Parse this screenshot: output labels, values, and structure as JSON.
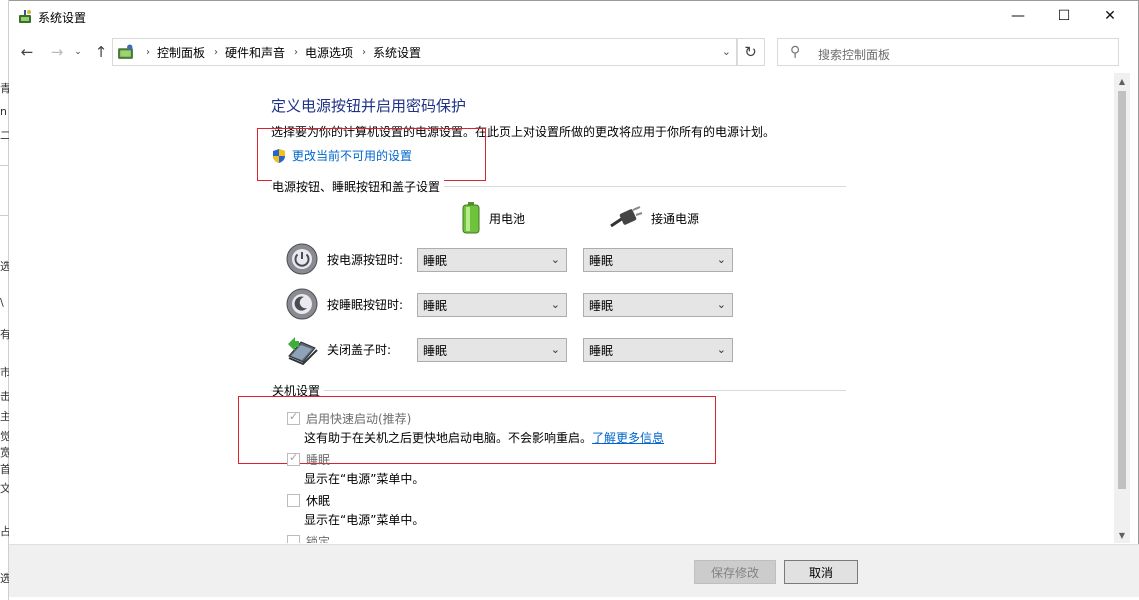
{
  "window": {
    "title": "系统设置",
    "controls": {
      "minimize": "—",
      "maximize": "☐",
      "close": "✕"
    }
  },
  "address_bar": {
    "breadcrumbs": [
      "控制面板",
      "硬件和声音",
      "电源选项",
      "系统设置"
    ],
    "search_placeholder": "搜索控制面板"
  },
  "page": {
    "heading": "定义电源按钮并启用密码保护",
    "description": "选择要为你的计算机设置的电源设置。在此页上对设置所做的更改将应用于你所有的电源计划。",
    "change_settings_link": "更改当前不可用的设置"
  },
  "power_buttons": {
    "group_title": "电源按钮、睡眠按钮和盖子设置",
    "columns": {
      "battery": "用电池",
      "plugged_in": "接通电源"
    },
    "rows": [
      {
        "label": "按电源按钮时:",
        "battery": "睡眠",
        "plugged_in": "睡眠",
        "icon": "power-button-icon"
      },
      {
        "label": "按睡眠按钮时:",
        "battery": "睡眠",
        "plugged_in": "睡眠",
        "icon": "sleep-button-icon"
      },
      {
        "label": "关闭盖子时:",
        "battery": "睡眠",
        "plugged_in": "睡眠",
        "icon": "laptop-lid-icon"
      }
    ]
  },
  "shutdown_settings": {
    "group_title": "关机设置",
    "items": [
      {
        "label": "启用快速启动(推荐)",
        "checked": true,
        "disabled": true,
        "description": "这有助于在关机之后更快地启动电脑。不会影响重启。",
        "link": "了解更多信息"
      },
      {
        "label": "睡眠",
        "checked": true,
        "disabled": true,
        "description": "显示在“电源”菜单中。"
      },
      {
        "label": "休眠",
        "checked": false,
        "disabled": false,
        "description": "显示在“电源”菜单中。"
      },
      {
        "label": "锁定",
        "checked": false,
        "disabled": true
      }
    ]
  },
  "footer": {
    "save_button": "保存修改",
    "cancel_button": "取消"
  },
  "colors": {
    "heading": "#1e3287",
    "link": "#0066cc",
    "highlight_box": "#d9232e"
  }
}
